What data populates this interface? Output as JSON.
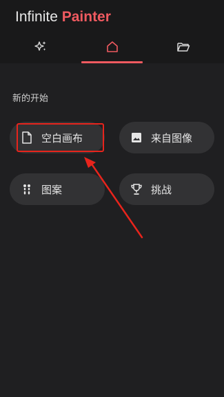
{
  "app": {
    "title_part1": "Infinite",
    "title_part2": "Painter",
    "accent_color": "#f05a60"
  },
  "tabs": [
    {
      "name": "sparkle-icon",
      "active": false
    },
    {
      "name": "home-icon",
      "active": true
    },
    {
      "name": "folder-icon",
      "active": false
    }
  ],
  "section": {
    "title": "新的开始"
  },
  "actions": {
    "blank_canvas": "空白画布",
    "from_image": "来自图像",
    "pattern": "图案",
    "challenge": "挑战"
  },
  "annotation": {
    "highlight_color": "#e8241c"
  }
}
